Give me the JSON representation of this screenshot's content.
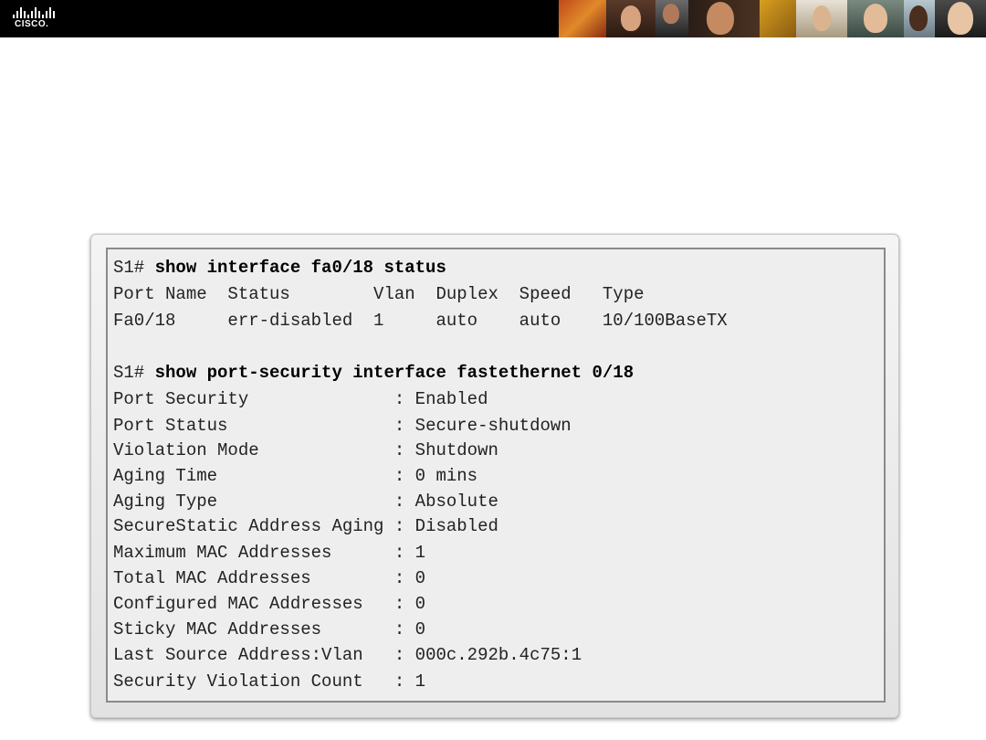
{
  "header": {
    "logo_text": "CISCO.",
    "logo_icon": "cisco-bridge-logo"
  },
  "terminal": {
    "commands": [
      {
        "prompt": "S1# ",
        "command": "show interface fa0/18 status"
      },
      {
        "prompt": "S1# ",
        "command": "show port-security interface fastethernet 0/18"
      }
    ],
    "status_table": {
      "header": "Port Name  Status        Vlan  Duplex  Speed   Type",
      "row": "Fa0/18     err-disabled  1     auto    auto    10/100BaseTX"
    },
    "port_security": [
      {
        "label": "Port Security              ",
        "value": ": Enabled"
      },
      {
        "label": "Port Status                ",
        "value": ": Secure-shutdown"
      },
      {
        "label": "Violation Mode             ",
        "value": ": Shutdown"
      },
      {
        "label": "Aging Time                 ",
        "value": ": 0 mins"
      },
      {
        "label": "Aging Type                 ",
        "value": ": Absolute"
      },
      {
        "label": "SecureStatic Address Aging ",
        "value": ": Disabled"
      },
      {
        "label": "Maximum MAC Addresses      ",
        "value": ": 1"
      },
      {
        "label": "Total MAC Addresses        ",
        "value": ": 0"
      },
      {
        "label": "Configured MAC Addresses   ",
        "value": ": 0"
      },
      {
        "label": "Sticky MAC Addresses       ",
        "value": ": 0"
      },
      {
        "label": "Last Source Address:Vlan   ",
        "value": ": 000c.292b.4c75:1"
      },
      {
        "label": "Security Violation Count   ",
        "value": ": 1"
      }
    ]
  }
}
